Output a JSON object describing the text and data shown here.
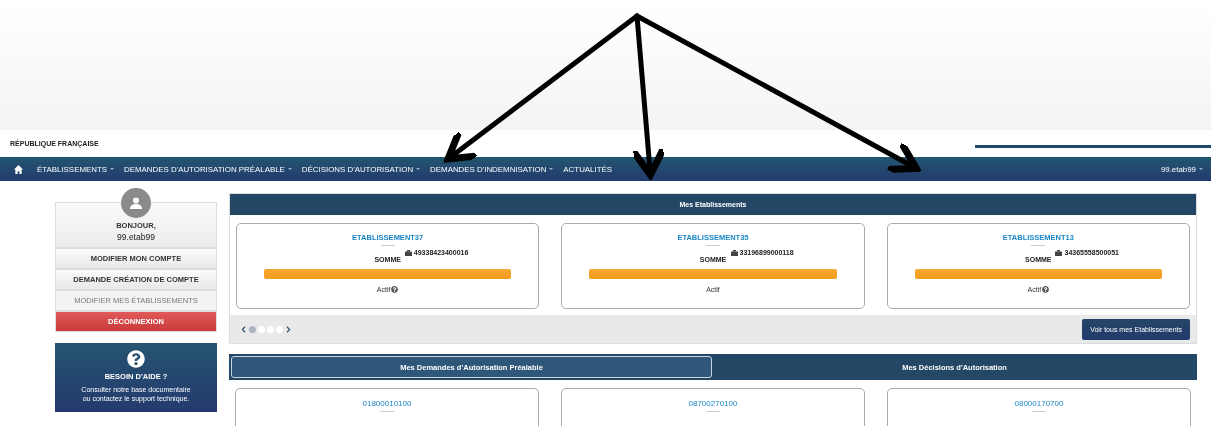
{
  "banner": {
    "title": "RÉPUBLIQUE FRANÇAISE"
  },
  "nav": {
    "items": [
      {
        "label": "ÉTABLISSEMENTS",
        "dropdown": true
      },
      {
        "label": "DEMANDES D'AUTORISATION PRÉALABLE",
        "dropdown": true
      },
      {
        "label": "DÉCISIONS D'AUTORISATION",
        "dropdown": true
      },
      {
        "label": "DEMANDES D'INDEMNISATION",
        "dropdown": true
      },
      {
        "label": "ACTUALITÉS",
        "dropdown": false
      }
    ],
    "user": {
      "label": "99.etab99",
      "dropdown": true
    }
  },
  "sidebar": {
    "greeting": "BONJOUR,",
    "username": "99.etab99",
    "menu": [
      {
        "label": "MODIFIER MON COMPTE",
        "kind": "button"
      },
      {
        "label": "DEMANDE CRÉATION DE COMPTE",
        "kind": "button"
      },
      {
        "label": "MODIFIER MES ÉTABLISSEMENTS",
        "kind": "link"
      },
      {
        "label": "DÉCONNEXION",
        "kind": "danger"
      }
    ],
    "help": {
      "title": "BESOIN D'AIDE ?",
      "text_1": "Consulter notre base documentaire",
      "text_2": "ou contactez le support technique."
    }
  },
  "establishments": {
    "title": "Mes Etablissements",
    "cards": [
      {
        "name": "ETABLISSEMENT37",
        "siret": "49338423400016",
        "department": "SOMME",
        "status": "Actif",
        "help": true
      },
      {
        "name": "ETABLISSEMENT35",
        "siret": "33196899000118",
        "department": "SOMME",
        "status": "Actif",
        "help": false
      },
      {
        "name": "ETABLISSEMENT13",
        "siret": "34365558500051",
        "department": "SOMME",
        "status": "Actif",
        "help": true
      }
    ],
    "dots": [
      {
        "selected": true
      },
      {
        "selected": false
      },
      {
        "selected": false
      },
      {
        "selected": false
      }
    ],
    "button": "Voir tous mes Etablissements"
  },
  "requests": {
    "tabs": [
      {
        "label": "Mes Demandes d'Autorisation Préalable",
        "selected": true
      },
      {
        "label": "Mes Décisions d'Autorisation",
        "selected": false
      }
    ],
    "cards": [
      {
        "number": "01800010100"
      },
      {
        "number": "08700270100"
      },
      {
        "number": "08000170700"
      }
    ]
  }
}
